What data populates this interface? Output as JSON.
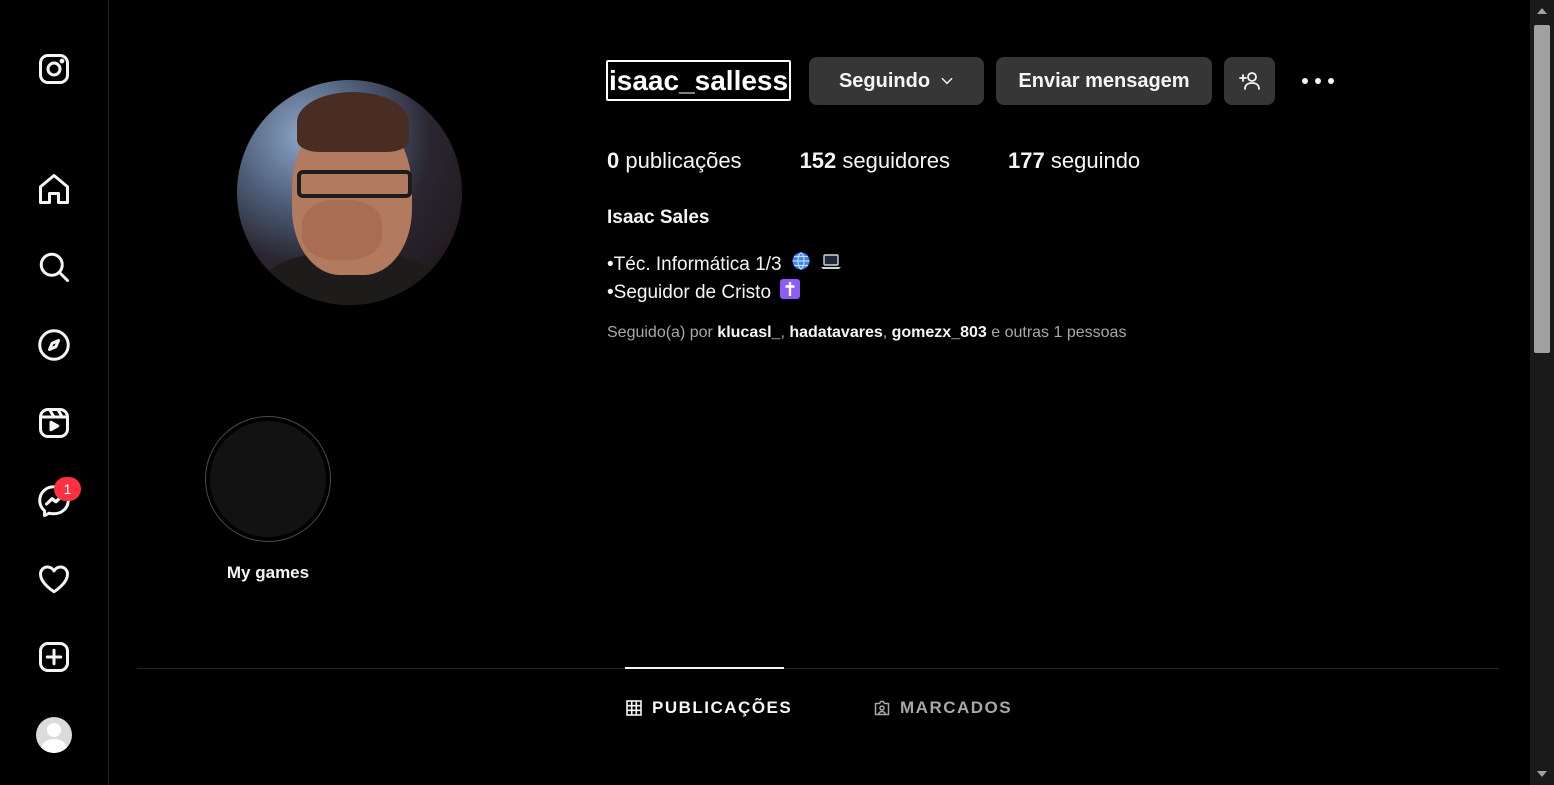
{
  "colors": {
    "background": "#000000",
    "button": "#363636",
    "badge": "#ff3040",
    "muted": "#a8a8a8"
  },
  "sidebar": {
    "items": [
      {
        "name": "instagram-logo-icon"
      },
      {
        "name": "home-icon"
      },
      {
        "name": "search-icon"
      },
      {
        "name": "explore-compass-icon"
      },
      {
        "name": "reels-icon"
      },
      {
        "name": "messenger-icon",
        "badge": "1"
      },
      {
        "name": "heart-icon"
      },
      {
        "name": "create-plus-icon"
      },
      {
        "name": "profile-avatar"
      }
    ]
  },
  "profile": {
    "username": "isaac_salless",
    "buttons": {
      "following": "Seguindo",
      "message": "Enviar mensagem"
    },
    "stats": {
      "posts_count": "0",
      "posts_label": " publicações",
      "followers_count": "152",
      "followers_label": " seguidores",
      "following_count": "177",
      "following_label": " seguindo"
    },
    "full_name": "Isaac Sales",
    "bio_line1": "•Téc. Informática 1/3",
    "bio_line2": "•Seguidor de Cristo",
    "followed_by": {
      "prefix": "Seguido(a) por ",
      "user1": "klucasl_",
      "sep1": ", ",
      "user2": "hadatavares",
      "sep2": ", ",
      "user3": "gomezx_803",
      "suffix": " e outras 1 pessoas"
    }
  },
  "highlights": [
    {
      "label": "My games"
    }
  ],
  "tabs": {
    "posts": "PUBLICAÇÕES",
    "tagged": "MARCADOS"
  }
}
